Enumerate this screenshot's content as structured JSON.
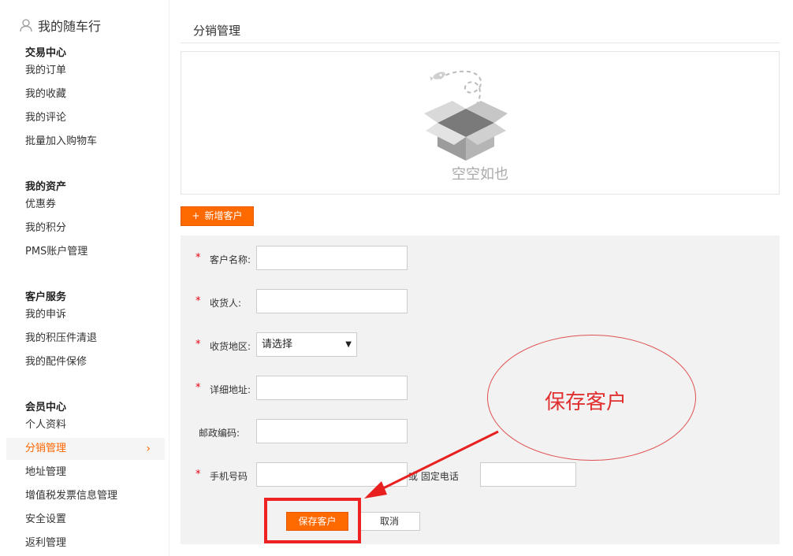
{
  "sidebar": {
    "header": "我的随车行",
    "groups": [
      {
        "title": "交易中心",
        "items": [
          "我的订单",
          "我的收藏",
          "我的评论",
          "批量加入购物车"
        ]
      },
      {
        "title": "我的资产",
        "items": [
          "优惠券",
          "我的积分",
          "PMS账户管理"
        ]
      },
      {
        "title": "客户服务",
        "items": [
          "我的申诉",
          "我的积压件清退",
          "我的配件保修"
        ]
      },
      {
        "title": "会员中心",
        "items": [
          "个人资料",
          "分销管理",
          "地址管理",
          "增值税发票信息管理",
          "安全设置",
          "返利管理"
        ]
      }
    ],
    "active_item": "分销管理"
  },
  "main": {
    "title": "分销管理",
    "empty_text": "空空如也",
    "add_button": "新增客户"
  },
  "form": {
    "required_mark": "*",
    "customer_name_label": "客户名称:",
    "consignee_label": "收货人:",
    "region_label": "收货地区:",
    "region_value": "请选择",
    "address_label": "详细地址:",
    "postcode_label": "邮政编码:",
    "mobile_label": "手机号码",
    "landline_label": "或 固定电话",
    "save_button": "保存客户",
    "cancel_button": "取消"
  },
  "annotation": {
    "text": "保存客户",
    "color": "#e03030"
  },
  "colors": {
    "accent": "#ff6a00",
    "required": "#e60012"
  }
}
